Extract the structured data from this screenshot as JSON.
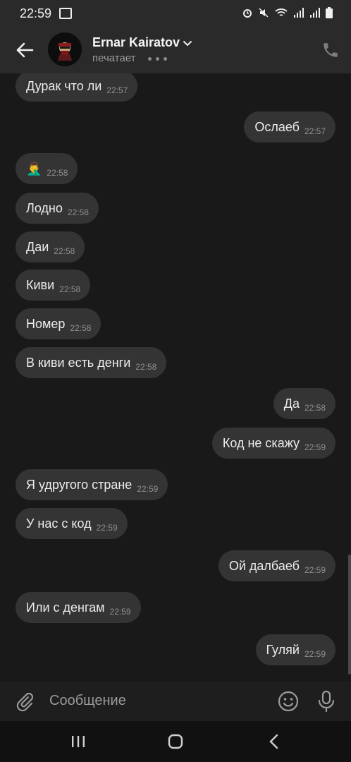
{
  "status_bar": {
    "time": "22:59"
  },
  "header": {
    "contact_name": "Ernar Kairatov",
    "status_text": "печатает"
  },
  "messages": [
    {
      "dir": "in",
      "text": "Дурак что ли",
      "time": "22:57"
    },
    {
      "dir": "out",
      "text": "Ослаеб",
      "time": "22:57"
    },
    {
      "dir": "in",
      "text": "🤦‍♂️",
      "time": "22:58"
    },
    {
      "dir": "in",
      "text": "Лодно",
      "time": "22:58"
    },
    {
      "dir": "in",
      "text": "Даи",
      "time": "22:58"
    },
    {
      "dir": "in",
      "text": "Киви",
      "time": "22:58"
    },
    {
      "dir": "in",
      "text": "Номер",
      "time": "22:58"
    },
    {
      "dir": "in",
      "text": "В киви есть денги",
      "time": "22:58"
    },
    {
      "dir": "out",
      "text": "Да",
      "time": "22:58"
    },
    {
      "dir": "out",
      "text": "Код не скажу",
      "time": "22:59"
    },
    {
      "dir": "in",
      "text": "Я удругого стране",
      "time": "22:59"
    },
    {
      "dir": "in",
      "text": "У нас с код",
      "time": "22:59"
    },
    {
      "dir": "out",
      "text": "Ой далбаеб",
      "time": "22:59"
    },
    {
      "dir": "in",
      "text": "Или с денгам",
      "time": "22:59"
    },
    {
      "dir": "out",
      "text": "Гуляй",
      "time": "22:59"
    }
  ],
  "composer": {
    "placeholder": "Сообщение"
  },
  "colors": {
    "background": "#191919",
    "bubble": "#343434",
    "header": "#2a2a2a"
  }
}
